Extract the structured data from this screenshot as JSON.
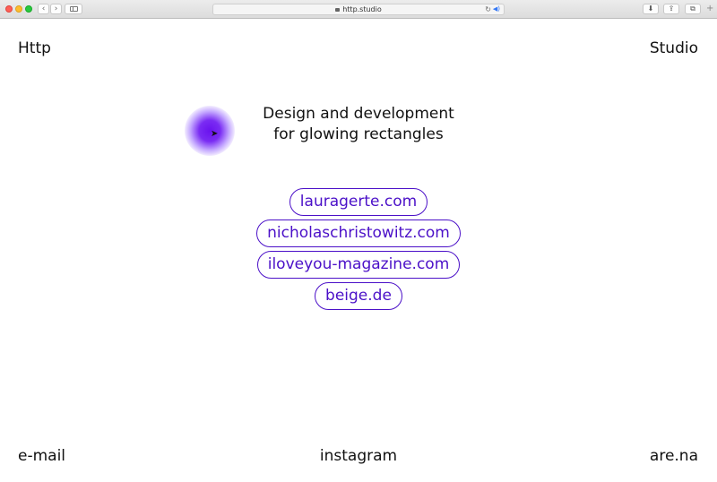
{
  "browser": {
    "url": "http.studio",
    "nav_back": "‹",
    "nav_forward": "›",
    "reload": "↻",
    "audio": "◀)",
    "download": "⬇",
    "share": "⇪",
    "tabs": "⧉",
    "new_tab": "+"
  },
  "header": {
    "brand_left": "Http",
    "brand_right": "Studio"
  },
  "hero": {
    "line1": "Design and development",
    "line2": "for glowing rectangles",
    "cursor": "➤"
  },
  "links": [
    {
      "label": "lauragerte.com"
    },
    {
      "label": "nicholaschristowitz.com"
    },
    {
      "label": "iloveyou-magazine.com"
    },
    {
      "label": "beige.de"
    }
  ],
  "footer": {
    "email": "e-mail",
    "instagram": "instagram",
    "arena": "are.na"
  },
  "colors": {
    "accent": "#4b10c8",
    "glow": "#6a12ee"
  }
}
